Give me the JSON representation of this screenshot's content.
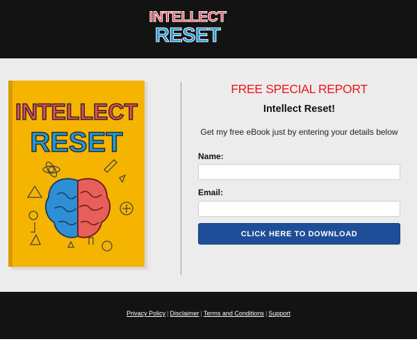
{
  "brand": {
    "logo_line1": "INTELLECT",
    "logo_line2": "RESET"
  },
  "book": {
    "title_line1": "INTELLECT",
    "title_line2": "RESET"
  },
  "optin": {
    "headline": "FREE SPECIAL REPORT",
    "subheadline": "Intellect Reset!",
    "description": "Get my free eBook just by entering your details below",
    "name_label": "Name:",
    "name_value": "",
    "email_label": "Email:",
    "email_value": "",
    "button_label": "CLICK HERE TO DOWNLOAD"
  },
  "footer": {
    "links": [
      "Privacy Policy",
      "Disclaimer",
      "Terms and Conditions",
      "Support"
    ],
    "separator": "|"
  },
  "colors": {
    "header_bg": "#131313",
    "main_bg": "#ececec",
    "headline": "#e8161b",
    "button": "#1f4e99",
    "book_cover": "#f5b400",
    "logo_red": "#f0465a",
    "logo_blue": "#1e9ad6"
  }
}
